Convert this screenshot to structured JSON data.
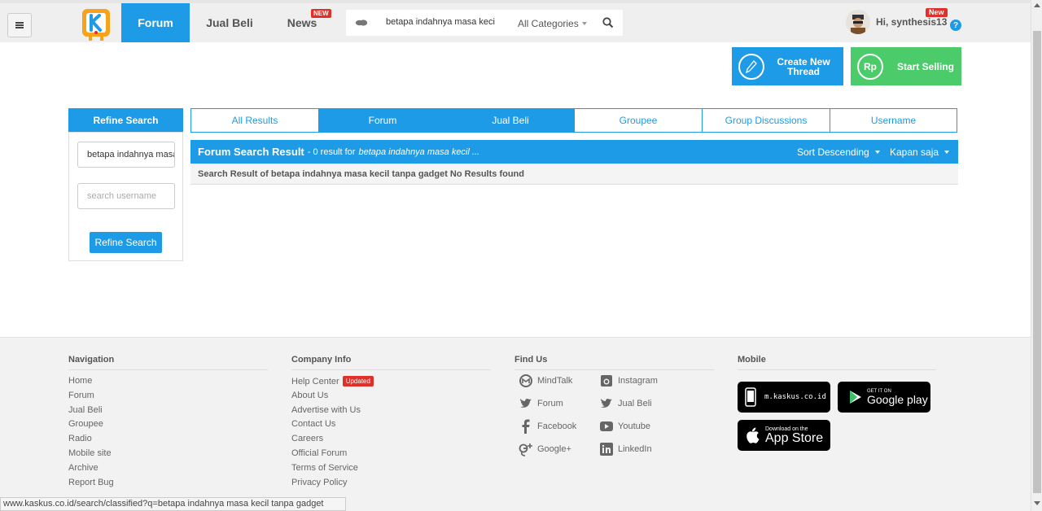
{
  "header": {
    "nav": [
      {
        "label": "Forum"
      },
      {
        "label": "Jual Beli"
      },
      {
        "label": "News"
      }
    ],
    "news_badge": "NEW",
    "search": {
      "query": "betapa indahnya masa keci",
      "category": "All Categories"
    },
    "user": {
      "greeting": "Hi, synthesis13",
      "badge": "New"
    },
    "help": "?"
  },
  "actions": {
    "create_thread": "Create New Thread",
    "start_selling": "Start Selling",
    "sell_icon_text": "Rp"
  },
  "refine": {
    "title": "Refine Search",
    "query_value": "betapa indahnya masa kecil tanpa gadget",
    "username_placeholder": "search username",
    "button": "Refine Search"
  },
  "tabs": [
    "All Results",
    "Forum",
    "Jual Beli",
    "Groupee",
    "Group Discussions",
    "Username"
  ],
  "results": {
    "title": "Forum Search Result",
    "count_text": "- 0 result for",
    "query_italic": "betapa indahnya masa kecil ...",
    "sort": "Sort Descending",
    "time": "Kapan saja",
    "message": "Search Result of betapa indahnya masa kecil tanpa gadget No Results found"
  },
  "footer": {
    "navigation": {
      "title": "Navigation",
      "items": [
        "Home",
        "Forum",
        "Jual Beli",
        "Groupee",
        "Radio",
        "Mobile site",
        "Archive",
        "Report Bug"
      ]
    },
    "company": {
      "title": "Company Info",
      "items": [
        "Help Center",
        "About Us",
        "Advertise with Us",
        "Contact Us",
        "Careers",
        "Official Forum",
        "Terms of Service",
        "Privacy Policy"
      ],
      "updated_badge": "Updated"
    },
    "find_us": {
      "title": "Find Us",
      "items": [
        "MindTalk",
        "Instagram",
        "Forum",
        "Jual Beli",
        "Facebook",
        "Youtube",
        "Google+",
        "LinkedIn"
      ]
    },
    "mobile": {
      "title": "Mobile",
      "mkaskus": "m.kaskus.co.id",
      "gplay_small": "GET IT ON",
      "gplay_big": "Google play",
      "appstore_small": "Download on the",
      "appstore_big": "App Store"
    }
  },
  "status_url": "www.kaskus.co.id/search/classified?q=betapa indahnya masa kecil tanpa gadget",
  "colors": {
    "primary": "#1e9be6",
    "sell": "#4ccb6a",
    "badge": "#e0302a"
  }
}
